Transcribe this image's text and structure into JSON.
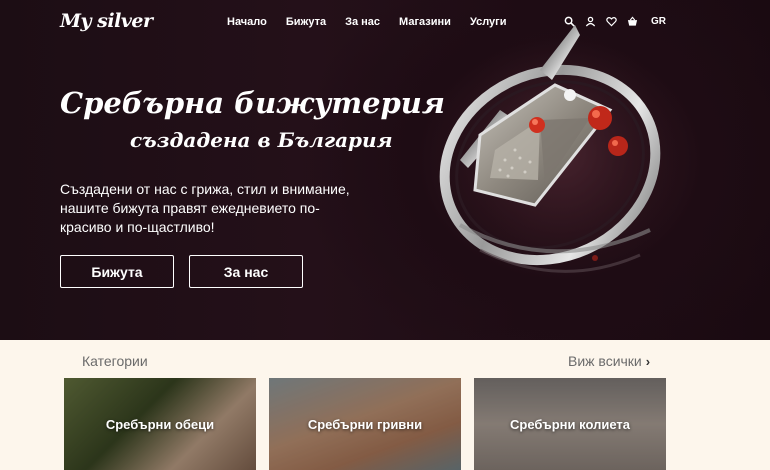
{
  "header": {
    "logo": "My silver",
    "nav": [
      "Начало",
      "Бижута",
      "За нас",
      "Магазини",
      "Услуги"
    ],
    "icons": [
      "search-icon",
      "user-icon",
      "heart-icon",
      "basket-icon"
    ],
    "language": "GR"
  },
  "hero": {
    "title": "Сребърна бижутерия",
    "subtitle": "създадена в България",
    "description": "Създадени от нас с грижа, стил и внимание, нашите бижута правят ежедневието по-красиво и по-щастливо!",
    "buttons": {
      "jewelry": "Бижута",
      "about": "За нас"
    }
  },
  "categories": {
    "heading": "Категории",
    "see_all": "Виж всички",
    "items": [
      {
        "label": "Сребърни обеци"
      },
      {
        "label": "Сребърни гривни"
      },
      {
        "label": "Сребърни колиета"
      }
    ]
  },
  "colors": {
    "hero_bg": "#1c0d14",
    "page_bg": "#fdf6ec",
    "muted_text": "#6b6b6b",
    "gem_red": "#d0301f"
  }
}
